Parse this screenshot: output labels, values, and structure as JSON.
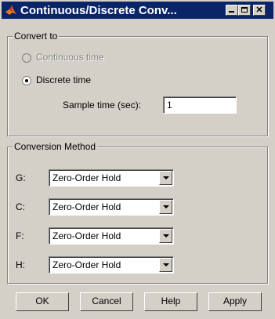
{
  "window": {
    "title": "Continuous/Discrete Conv..."
  },
  "convert_group": {
    "label": "Convert to",
    "continuous_label": "Continuous time",
    "discrete_label": "Discrete time",
    "selected": "discrete",
    "sample_time_label": "Sample time (sec):",
    "sample_time_value": "1"
  },
  "method_group": {
    "label": "Conversion Method",
    "rows": [
      {
        "key": "G:",
        "value": "Zero-Order Hold"
      },
      {
        "key": "C:",
        "value": "Zero-Order Hold"
      },
      {
        "key": "F:",
        "value": "Zero-Order Hold"
      },
      {
        "key": "H:",
        "value": "Zero-Order Hold"
      }
    ]
  },
  "buttons": {
    "ok": "OK",
    "cancel": "Cancel",
    "help": "Help",
    "apply": "Apply"
  },
  "colors": {
    "titlebar": "#0a246a",
    "dialog_bg": "#d4d0c8"
  }
}
